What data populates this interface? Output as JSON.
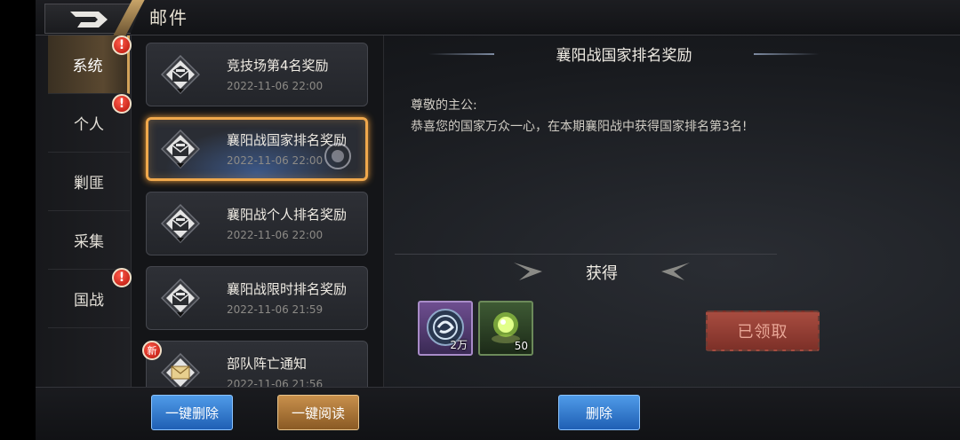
{
  "header": {
    "title": "邮件",
    "back_icon": "back-arrow-icon"
  },
  "categories": [
    {
      "label": "系统",
      "active": true,
      "alert": "!"
    },
    {
      "label": "个人",
      "active": false,
      "alert": "!"
    },
    {
      "label": "剿匪",
      "active": false,
      "alert": ""
    },
    {
      "label": "采集",
      "active": false,
      "alert": ""
    },
    {
      "label": "国战",
      "active": false,
      "alert": "!"
    }
  ],
  "mails": [
    {
      "title": "竞技场第4名奖励",
      "date": "2022-11-06   22:00",
      "read": true
    },
    {
      "title": "襄阳战国家排名奖励",
      "date": "2022-11-06   22:00",
      "read": true,
      "selected": true
    },
    {
      "title": "襄阳战个人排名奖励",
      "date": "2022-11-06   22:00",
      "read": true
    },
    {
      "title": "襄阳战限时排名奖励",
      "date": "2022-11-06   21:59",
      "read": true
    },
    {
      "title": "部队阵亡通知",
      "date": "2022-11-06   21:56",
      "read": false,
      "badge": "新"
    }
  ],
  "detail": {
    "title": "襄阳战国家排名奖励",
    "greeting": "尊敬的主公:",
    "body": "恭喜您的国家万众一心，在本期襄阳战中获得国家排名第3名!",
    "rewards_label": "获得",
    "rewards": [
      {
        "icon": "dragon-coin-icon",
        "count": "2万"
      },
      {
        "icon": "green-orb-icon",
        "count": "50"
      }
    ],
    "claimed_label": "已领取"
  },
  "footer": {
    "delete_all": "一键删除",
    "read_all": "一键阅读",
    "delete": "删除"
  },
  "colors": {
    "accent": "#f0a84c",
    "alert": "#d8281c",
    "button_blue": "#2f74c8"
  }
}
